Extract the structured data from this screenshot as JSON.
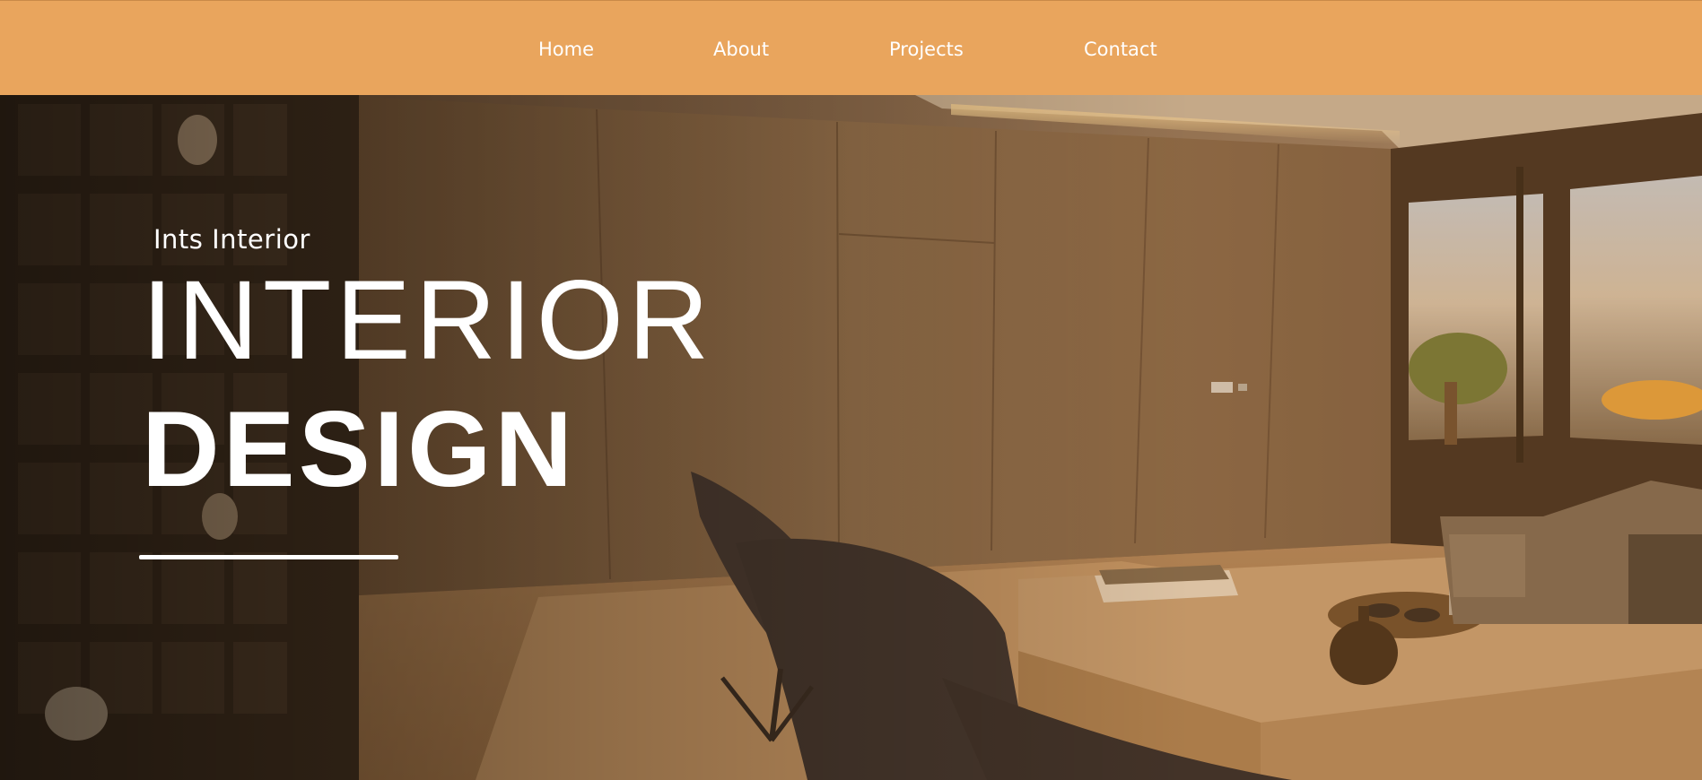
{
  "nav": {
    "items": [
      {
        "label": "Home"
      },
      {
        "label": "About"
      },
      {
        "label": "Projects"
      },
      {
        "label": "Contact"
      }
    ]
  },
  "hero": {
    "eyebrow": "Ints Interior",
    "title_line1": "INTERIOR",
    "title_line2": "DESIGN",
    "background_image": "interior-living-room-photo"
  },
  "colors": {
    "nav_background": "#e9a55d",
    "text": "#ffffff",
    "overlay": "#b06a20"
  }
}
